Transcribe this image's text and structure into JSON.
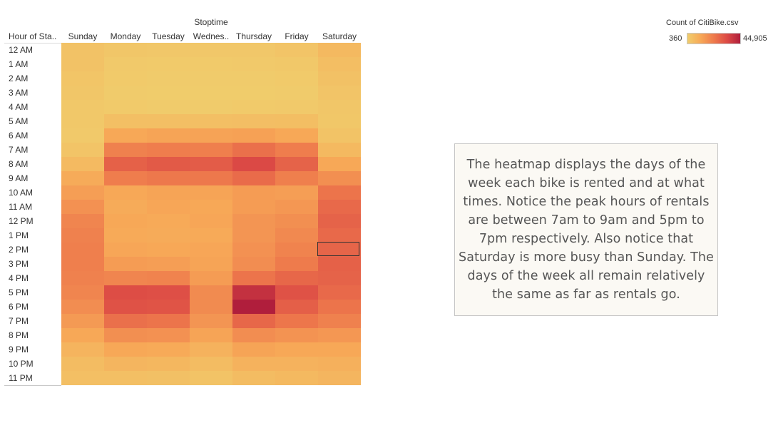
{
  "chart_data": {
    "type": "heatmap",
    "column_title": "Stoptime",
    "row_header": "Hour of Sta..",
    "columns": [
      "Sunday",
      "Monday",
      "Tuesday",
      "Wednes..",
      "Thursday",
      "Friday",
      "Saturday"
    ],
    "rows": [
      "12 AM",
      "1 AM",
      "2 AM",
      "3 AM",
      "4 AM",
      "5 AM",
      "6 AM",
      "7 AM",
      "8 AM",
      "9 AM",
      "10 AM",
      "11 AM",
      "12 PM",
      "1 PM",
      "2 PM",
      "3 PM",
      "4 PM",
      "5 PM",
      "6 PM",
      "7 PM",
      "8 PM",
      "9 PM",
      "10 PM",
      "11 PM"
    ],
    "values": [
      [
        3800,
        2600,
        2100,
        2100,
        2200,
        3000,
        6500
      ],
      [
        3600,
        1600,
        1400,
        1400,
        1500,
        2000,
        4900
      ],
      [
        2900,
        1200,
        1000,
        1000,
        1100,
        1400,
        4000
      ],
      [
        2500,
        900,
        700,
        700,
        800,
        1100,
        3200
      ],
      [
        2000,
        1200,
        1100,
        1100,
        1200,
        1500,
        2500
      ],
      [
        1800,
        4500,
        4500,
        4600,
        4800,
        5000,
        2300
      ],
      [
        1600,
        11500,
        12500,
        12800,
        13200,
        11500,
        3500
      ],
      [
        3000,
        21000,
        22000,
        21500,
        25000,
        22000,
        6500
      ],
      [
        6000,
        28500,
        30000,
        29500,
        34000,
        28000,
        11500
      ],
      [
        10500,
        22000,
        23000,
        23000,
        26000,
        21500,
        17500
      ],
      [
        14000,
        11500,
        12500,
        12500,
        14500,
        14000,
        24000
      ],
      [
        17000,
        10500,
        12000,
        11500,
        14500,
        15500,
        26500
      ],
      [
        20000,
        11500,
        11000,
        12000,
        16000,
        17500,
        28000
      ],
      [
        21000,
        11000,
        10500,
        11000,
        16000,
        19000,
        26500
      ],
      [
        21500,
        12000,
        11500,
        12000,
        17000,
        20500,
        27500
      ],
      [
        21500,
        14500,
        14000,
        12500,
        18000,
        22500,
        28500
      ],
      [
        21000,
        20000,
        20500,
        14500,
        24000,
        27000,
        28000
      ],
      [
        20000,
        33000,
        32500,
        18500,
        40000,
        32000,
        26500
      ],
      [
        18000,
        32000,
        31500,
        18500,
        44905,
        29000,
        24000
      ],
      [
        15000,
        25000,
        24000,
        16000,
        27000,
        23500,
        21000
      ],
      [
        11500,
        17500,
        17000,
        12500,
        18000,
        16500,
        15500
      ],
      [
        8000,
        11500,
        11000,
        8500,
        12500,
        11500,
        11500
      ],
      [
        5500,
        7500,
        7000,
        5500,
        8500,
        8500,
        9000
      ],
      [
        4500,
        4500,
        4200,
        3500,
        5500,
        6500,
        7500
      ]
    ],
    "value_range": [
      360,
      44905
    ],
    "color_scale": [
      "#f0cd6c",
      "#f7a857",
      "#ee7a4c",
      "#dc4a45",
      "#b01e3c"
    ],
    "selected_cell": {
      "row": "2 PM",
      "column": "Saturday"
    }
  },
  "legend": {
    "title": "Count of CitiBike.csv",
    "min_label": "360",
    "max_label": "44,905"
  },
  "annotation": {
    "text": "The heatmap displays the days of the week each bike is rented and at what times. Notice the peak hours of rentals are between 7am to 9am and 5pm to 7pm respectively. Also notice that Saturday is more busy than Sunday. The days of the week all remain relatively the same as far as rentals go."
  }
}
